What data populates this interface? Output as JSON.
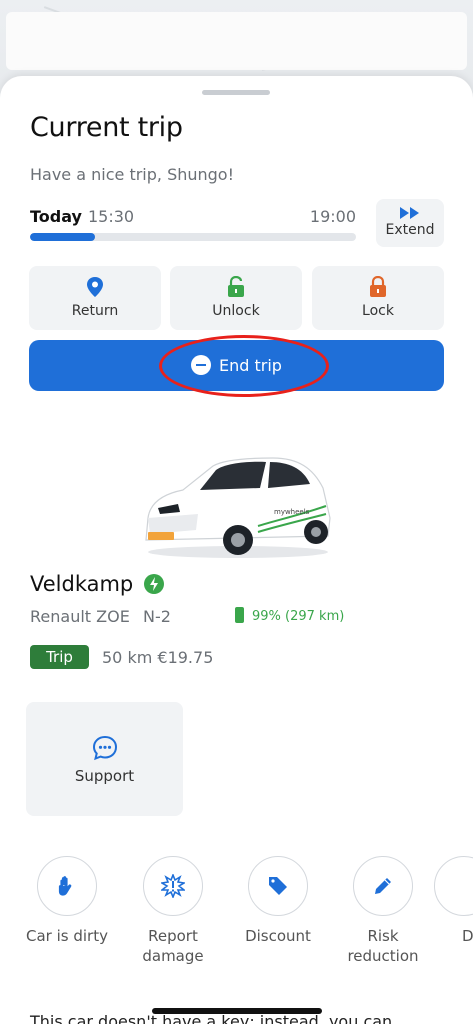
{
  "header": {
    "title": "Current trip",
    "greeting": "Have a nice trip, Shungo!"
  },
  "schedule": {
    "day_label": "Today",
    "start_time": "15:30",
    "end_time": "19:00",
    "progress_fraction": 0.2,
    "extend_label": "Extend"
  },
  "actions": [
    {
      "label": "Return",
      "icon": "location-pin-icon",
      "color": "#1f6fd8"
    },
    {
      "label": "Unlock",
      "icon": "unlocked-padlock-icon",
      "color": "#3aa64b"
    },
    {
      "label": "Lock",
      "icon": "locked-padlock-icon",
      "color": "#e0662a"
    }
  ],
  "end_trip": {
    "label": "End trip",
    "icon": "minus-circle-icon",
    "color": "#1f6fd8"
  },
  "car": {
    "name": "Veldkamp",
    "model": "Renault ZOE",
    "plate": "N-2",
    "battery": "99% (297 km)",
    "trip_badge": "Trip",
    "trip_summary": "50 km  €19.75",
    "livery_text": "mywheels"
  },
  "support": {
    "label": "Support",
    "icon": "chat-bubble-icon"
  },
  "quick_actions": [
    {
      "label": "Car is dirty",
      "icon": "hand-icon"
    },
    {
      "label": "Report damage",
      "icon": "damage-alert-icon"
    },
    {
      "label": "Discount",
      "icon": "tag-icon"
    },
    {
      "label": "Risk reduction",
      "icon": "pencil-icon"
    },
    {
      "label": "D",
      "icon": ""
    }
  ],
  "footer": {
    "text": "This car doesn't have a key; instead, you can"
  },
  "colors": {
    "primary": "#1f6fd8",
    "success": "#3aa64b",
    "trip_badge": "#2e7d3a",
    "highlight": "#e8211b"
  }
}
